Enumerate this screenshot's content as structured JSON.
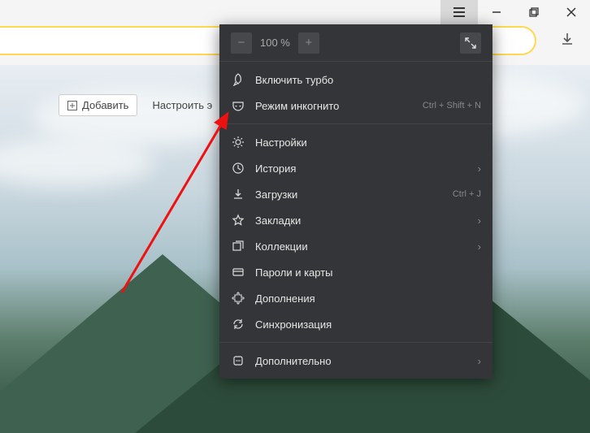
{
  "zoom": {
    "minus": "−",
    "plus": "+",
    "value": "100 %"
  },
  "toolbar": {
    "add": "Добавить",
    "customize": "Настроить э"
  },
  "menu": {
    "turbo": "Включить турбо",
    "incognito": {
      "label": "Режим инкогнито",
      "shortcut": "Ctrl + Shift + N"
    },
    "settings": "Настройки",
    "history": "История",
    "downloads": {
      "label": "Загрузки",
      "shortcut": "Ctrl + J"
    },
    "bookmarks": "Закладки",
    "collections": "Коллекции",
    "passwords": "Пароли и карты",
    "addons": "Дополнения",
    "sync": "Синхронизация",
    "more": "Дополнительно"
  }
}
